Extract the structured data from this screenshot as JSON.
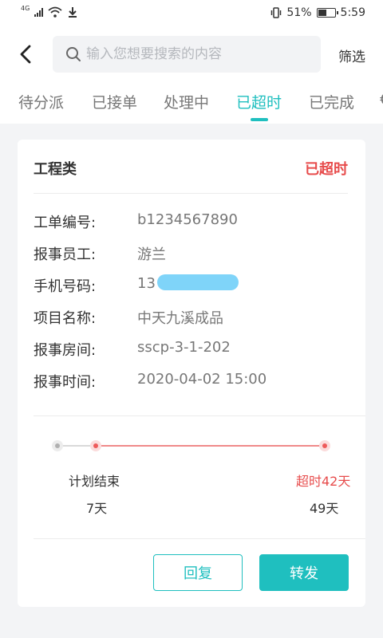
{
  "status_bar": {
    "network": "4G",
    "battery_percent": "51%",
    "battery_level": 0.51,
    "time": "5:59"
  },
  "header": {
    "search_placeholder": "输入您想要搜索的内容",
    "filter_label": "筛选"
  },
  "tabs": [
    {
      "label": "待分派",
      "active": false
    },
    {
      "label": "已接单",
      "active": false
    },
    {
      "label": "处理中",
      "active": false
    },
    {
      "label": "已超时",
      "active": true
    },
    {
      "label": "已完成",
      "active": false
    },
    {
      "label": "€",
      "active": false
    }
  ],
  "order": {
    "type": "工程类",
    "status": "已超时",
    "status_color": "#e74c4c",
    "fields": [
      {
        "label": "工单编号:",
        "value": "b1234567890"
      },
      {
        "label": "报事员工:",
        "value": "游兰"
      },
      {
        "label": "手机号码:",
        "value": "13"
      },
      {
        "label": "项目名称:",
        "value": "中天九溪成品"
      },
      {
        "label": "报事房间:",
        "value": "sscp-3-1-202"
      },
      {
        "label": "报事时间:",
        "value": "2020-04-02 15:00"
      }
    ],
    "timeline": {
      "plan_label": "计划结束",
      "plan_days": "7天",
      "overdue_label": "超时42天",
      "overdue_days": "49天"
    },
    "actions": {
      "reply": "回复",
      "forward": "转发"
    }
  },
  "colors": {
    "accent": "#1fbfbf",
    "danger": "#e74c4c",
    "masked_phone": "#7fd4f9"
  }
}
